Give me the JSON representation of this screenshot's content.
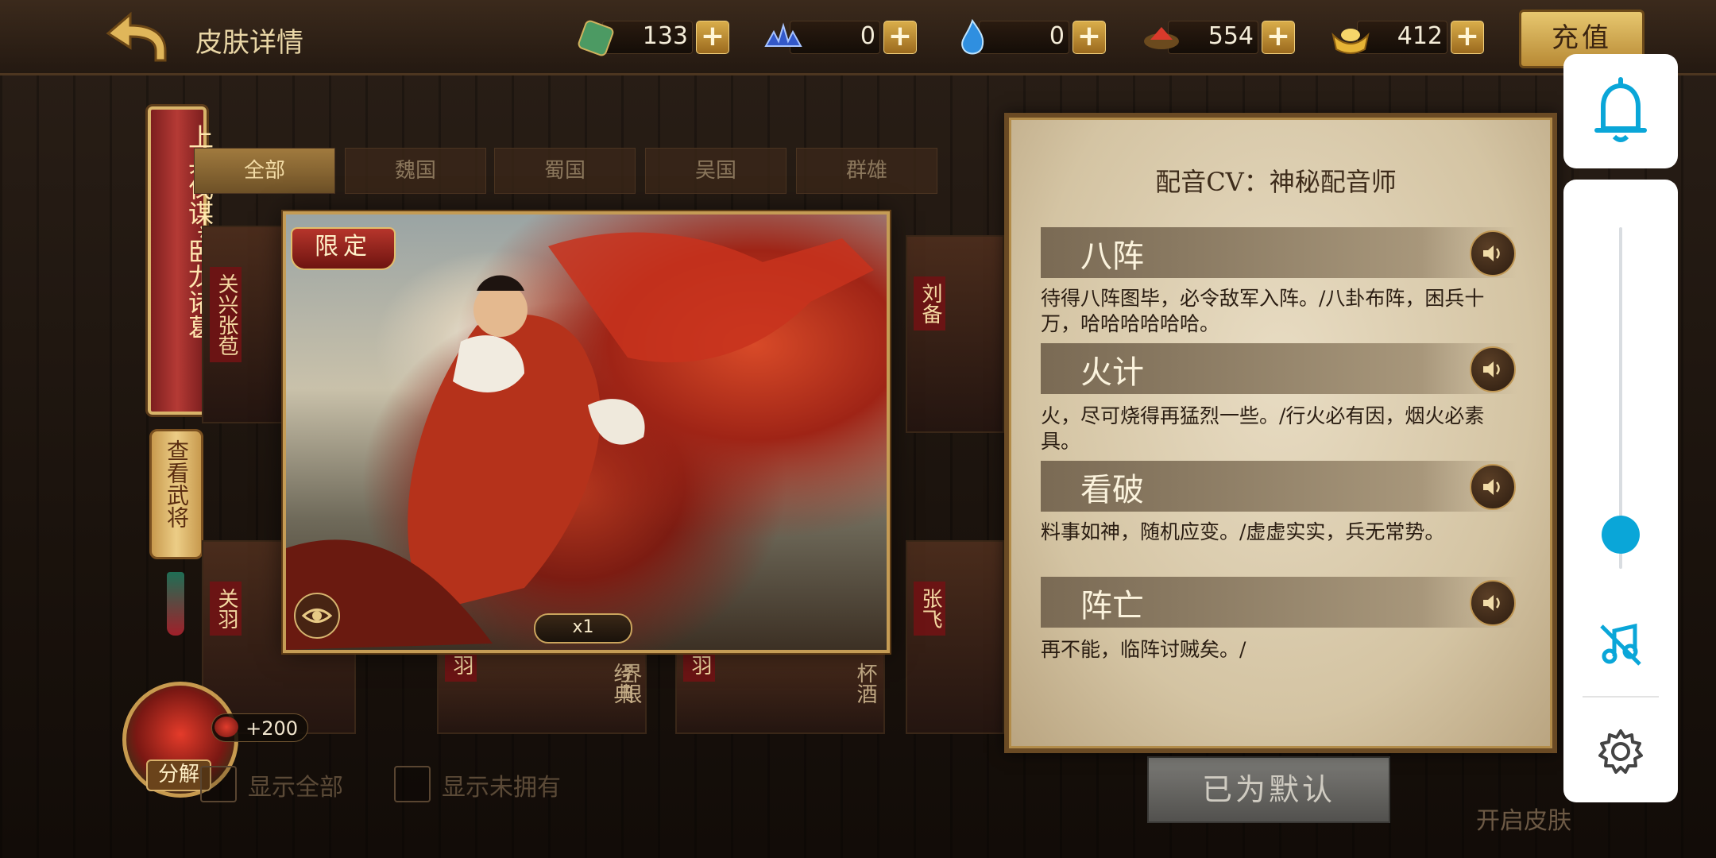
{
  "header": {
    "title": "皮肤详情",
    "recharge_label": "充值"
  },
  "resources": [
    {
      "icon": "jade-token-icon",
      "value": "133"
    },
    {
      "icon": "blue-crest-icon",
      "value": "0"
    },
    {
      "icon": "blue-flame-icon",
      "value": "0"
    },
    {
      "icon": "red-gem-icon",
      "value": "554"
    },
    {
      "icon": "gold-ingot-icon",
      "value": "412"
    }
  ],
  "hero": {
    "name_banner": "上兵伐谋*卧龙诸葛",
    "view_hero_label": "查看武将"
  },
  "tabs": [
    "全部",
    "魏国",
    "蜀国",
    "吴国",
    "群雄"
  ],
  "cards": [
    {
      "name": "关兴张苞"
    },
    {
      "name": "刘备"
    },
    {
      "name": "关羽"
    },
    {
      "name": "羽"
    },
    {
      "name": "羽"
    },
    {
      "name": "张飞"
    }
  ],
  "card_suffixes": [
    "经典",
    "界限",
    "杯酒"
  ],
  "skin": {
    "badge": "限定",
    "count": "x1"
  },
  "decompose": {
    "label": "分解",
    "bonus": "+200"
  },
  "filters": {
    "show_all": "显示全部",
    "show_unowned": "显示未拥有"
  },
  "actions": {
    "default_label": "已为默认",
    "open_skin_label": "开启皮肤"
  },
  "voice_panel": {
    "cv_title": "配音CV：神秘配音师",
    "lines": [
      {
        "name": "八阵",
        "text": "待得八阵图毕，必令敌军入阵。/八卦布阵，困兵十万，哈哈哈哈哈哈。"
      },
      {
        "name": "火计",
        "text": "火，尽可烧得再猛烈一些。/行火必有因，烟火必素具。"
      },
      {
        "name": "看破",
        "text": "料事如神，随机应变。/虚虚实实，兵无常势。"
      },
      {
        "name": "阵亡",
        "text": "再不能，临阵讨贼矣。/"
      }
    ]
  },
  "overlay": {
    "volume_level": 0.1
  }
}
